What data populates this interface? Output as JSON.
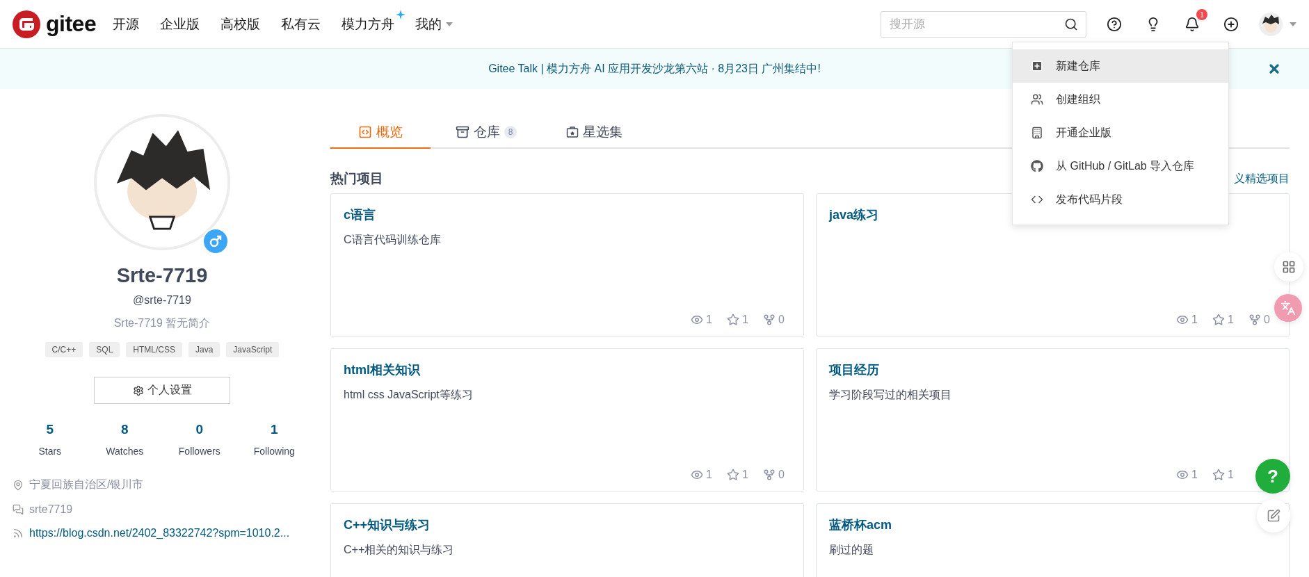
{
  "header": {
    "logo": "gitee",
    "nav": [
      {
        "label": "开源",
        "kind": "plain"
      },
      {
        "label": "企业版",
        "kind": "plain"
      },
      {
        "label": "高校版",
        "kind": "plain"
      },
      {
        "label": "私有云",
        "kind": "plain"
      },
      {
        "label": "模力方舟",
        "kind": "sparkle"
      },
      {
        "label": "我的",
        "kind": "dropdown"
      }
    ],
    "search": {
      "placeholder": "搜开源"
    },
    "notification_count": "1"
  },
  "banner": {
    "text": "Gitee Talk | 模力方舟 AI 应用开发沙龙第六站 · 8月23日 广州集结中!"
  },
  "create_menu": [
    {
      "label": "新建仓库",
      "kind": "repo",
      "selected": true
    },
    {
      "label": "创建组织",
      "kind": "team",
      "selected": false
    },
    {
      "label": "开通企业版",
      "kind": "enterprise",
      "selected": false
    },
    {
      "label": "从 GitHub / GitLab 导入仓库",
      "kind": "import",
      "selected": false
    },
    {
      "label": "发布代码片段",
      "kind": "snippet",
      "selected": false
    }
  ],
  "profile": {
    "name": "Srte-7719",
    "handle": "@srte-7719",
    "bio": "Srte-7719 暂无简介",
    "tags": [
      "C/C++",
      "SQL",
      "HTML/CSS",
      "Java",
      "JavaScript"
    ],
    "settings_button": "个人设置",
    "stats": [
      {
        "value": "5",
        "label": "Stars"
      },
      {
        "value": "8",
        "label": "Watches"
      },
      {
        "value": "0",
        "label": "Followers"
      },
      {
        "value": "1",
        "label": "Following"
      }
    ],
    "info": [
      {
        "kind": "location",
        "text": "宁夏回族自治区/银川市"
      },
      {
        "kind": "wechat",
        "text": "srte7719"
      },
      {
        "kind": "blog",
        "text": "https://blog.csdn.net/2402_83322742?spm=1010.2..."
      }
    ]
  },
  "tabs": [
    {
      "label": "概览",
      "kind": "overview",
      "selected": true
    },
    {
      "label": "仓库",
      "kind": "repos",
      "count": "8",
      "selected": false
    },
    {
      "label": "星选集",
      "kind": "collections",
      "selected": false
    }
  ],
  "section": {
    "title": "热门项目",
    "link": "义精选项目"
  },
  "projects": [
    {
      "title": "c语言",
      "description": "C语言代码训练仓库",
      "stats": [
        {
          "kind": "watch",
          "value": "1"
        },
        {
          "kind": "star",
          "value": "1"
        },
        {
          "kind": "fork",
          "value": "0"
        }
      ]
    },
    {
      "title": "java练习",
      "stats": [
        {
          "kind": "watch",
          "value": "1"
        },
        {
          "kind": "star",
          "value": "1"
        },
        {
          "kind": "fork",
          "value": "0"
        }
      ]
    },
    {
      "title": "html相关知识",
      "description": "html css JavaScript等练习",
      "stats": [
        {
          "kind": "watch",
          "value": "1"
        },
        {
          "kind": "star",
          "value": "1"
        },
        {
          "kind": "fork",
          "value": "0"
        }
      ]
    },
    {
      "title": "项目经历",
      "description": "学习阶段写过的相关项目",
      "stats": [
        {
          "kind": "watch",
          "value": "1"
        },
        {
          "kind": "star",
          "value": "1"
        }
      ]
    },
    {
      "title": "C++知识与练习",
      "description": "C++相关的知识与练习"
    },
    {
      "title": "蓝桥杯acm",
      "description": "刷过的题"
    }
  ],
  "help_button": "?"
}
